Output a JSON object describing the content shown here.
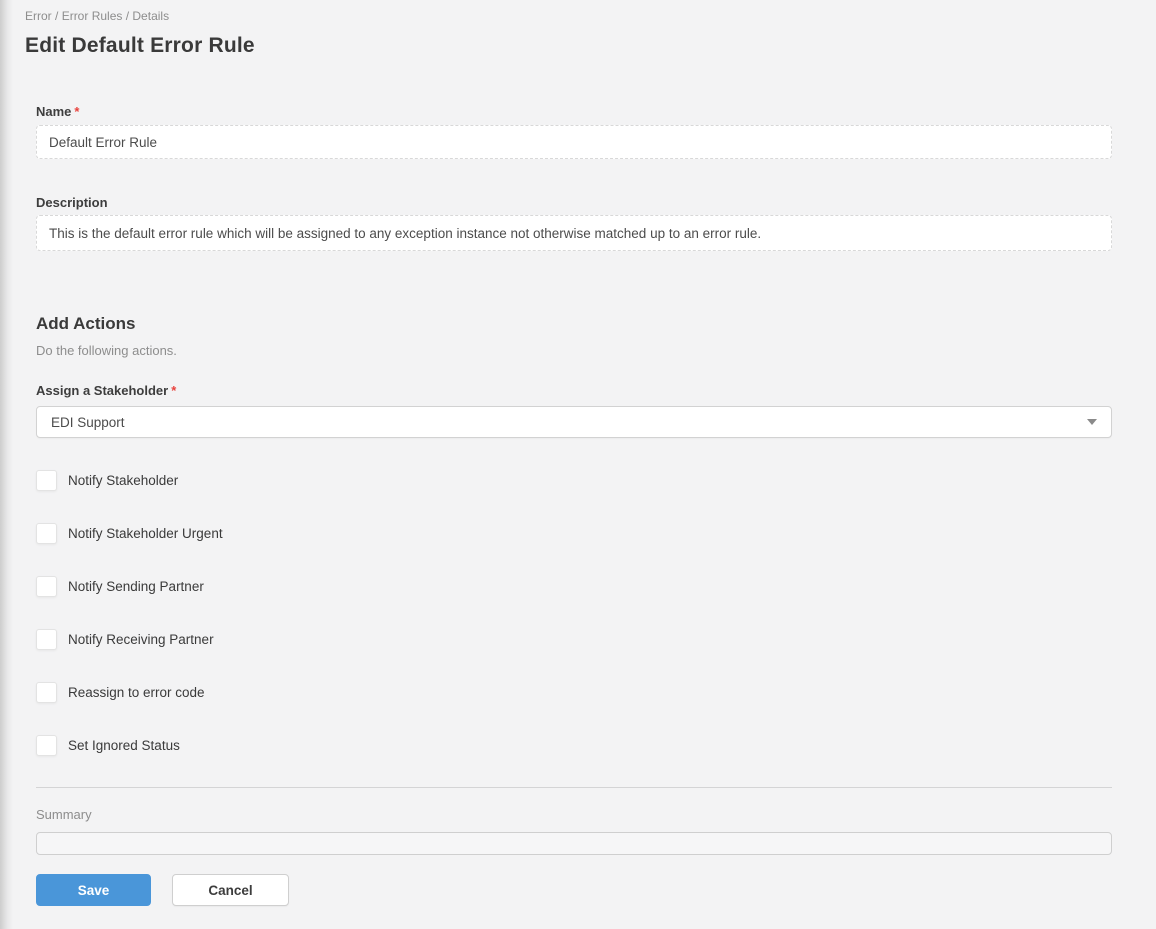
{
  "breadcrumb": {
    "items": [
      "Error",
      "Error Rules",
      "Details"
    ],
    "separator": " / "
  },
  "page": {
    "title": "Edit Default Error Rule"
  },
  "form": {
    "name": {
      "label": "Name",
      "required_marker": "*",
      "value": "Default Error Rule"
    },
    "description": {
      "label": "Description",
      "value": "This is the default error rule which will be assigned to any exception instance not otherwise matched up to an error rule."
    },
    "add_actions": {
      "heading": "Add Actions",
      "subtitle": "Do the following actions."
    },
    "stakeholder": {
      "label": "Assign a Stakeholder",
      "required_marker": "*",
      "selected_value": "EDI Support"
    },
    "checkboxes": [
      {
        "label": "Notify Stakeholder",
        "checked": false
      },
      {
        "label": "Notify Stakeholder Urgent",
        "checked": false
      },
      {
        "label": "Notify Sending Partner",
        "checked": false
      },
      {
        "label": "Notify Receiving Partner",
        "checked": false
      },
      {
        "label": "Reassign to error code",
        "checked": false
      },
      {
        "label": "Set Ignored Status",
        "checked": false
      }
    ],
    "summary": {
      "label": "Summary",
      "value": ""
    },
    "buttons": {
      "save": "Save",
      "cancel": "Cancel"
    }
  },
  "colors": {
    "accent_blue": "#4a96d9",
    "required_red": "#e8413c",
    "page_background": "#f3f3f4"
  }
}
